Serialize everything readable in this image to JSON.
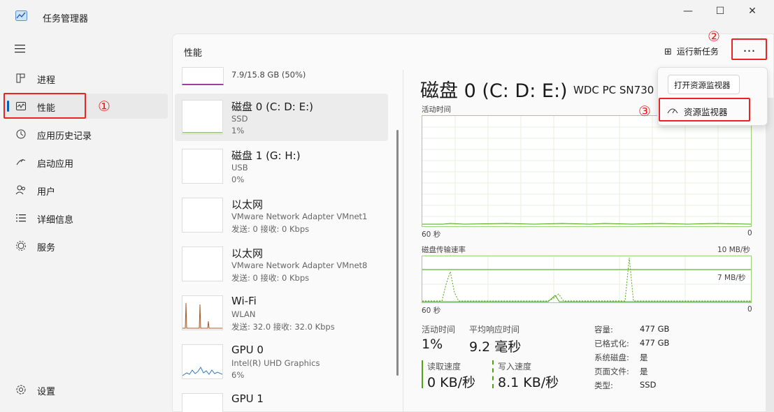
{
  "window": {
    "title": "任务管理器",
    "minimize": "—",
    "maximize": "☐",
    "close": "✕"
  },
  "sidebar": {
    "items": [
      {
        "label": "进程",
        "icon": "processes-icon"
      },
      {
        "label": "性能",
        "icon": "performance-icon"
      },
      {
        "label": "应用历史记录",
        "icon": "history-icon"
      },
      {
        "label": "启动应用",
        "icon": "startup-icon"
      },
      {
        "label": "用户",
        "icon": "users-icon"
      },
      {
        "label": "详细信息",
        "icon": "details-icon"
      },
      {
        "label": "服务",
        "icon": "services-icon"
      }
    ],
    "settings": "设置"
  },
  "annotations": {
    "n1": "①",
    "n2": "②",
    "n3": "③"
  },
  "header": {
    "title": "性能",
    "run_task": "运行新任务",
    "more": "…"
  },
  "list": {
    "partial_memory": "7.9/15.8 GB (50%)",
    "items": [
      {
        "t1": "磁盘 0 (C: D: E:)",
        "t2": "SSD",
        "t3": "1%"
      },
      {
        "t1": "磁盘 1 (G: H:)",
        "t2": "USB",
        "t3": "0%"
      },
      {
        "t1": "以太网",
        "t2": "VMware Network Adapter VMnet1",
        "t3": "发送: 0 接收: 0 Kbps"
      },
      {
        "t1": "以太网",
        "t2": "VMware Network Adapter VMnet8",
        "t3": "发送: 0 接收: 0 Kbps"
      },
      {
        "t1": "Wi-Fi",
        "t2": "WLAN",
        "t3": "发送: 32.0 接收: 32.0 Kbps"
      },
      {
        "t1": "GPU 0",
        "t2": "Intel(R) UHD Graphics",
        "t3": "6%"
      },
      {
        "t1": "GPU 1",
        "t2": "",
        "t3": ""
      }
    ]
  },
  "detail": {
    "title": "磁盘 0 (C: D: E:)",
    "model": "WDC PC SN730",
    "graph1": {
      "label": "活动时间",
      "left": "60 秒",
      "right": "0"
    },
    "graph2": {
      "label": "磁盘传输速率",
      "max": "10 MB/秒",
      "mid": "7 MB/秒",
      "left": "60 秒",
      "right": "0"
    },
    "stats": {
      "active_label": "活动时间",
      "active_value": "1%",
      "avg_label": "平均响应时间",
      "avg_value": "9.2 毫秒",
      "read_label": "读取速度",
      "read_value": "0 KB/秒",
      "write_label": "写入速度",
      "write_value": "8.1 KB/秒"
    },
    "props": [
      {
        "k": "容量:",
        "v": "477 GB"
      },
      {
        "k": "已格式化:",
        "v": "477 GB"
      },
      {
        "k": "系统磁盘:",
        "v": "是"
      },
      {
        "k": "页面文件:",
        "v": "是"
      },
      {
        "k": "类型:",
        "v": "SSD"
      }
    ]
  },
  "menu": {
    "tooltip": "打开资源监视器",
    "resmon": "资源监视器"
  },
  "colors": {
    "accent": "#005fb8",
    "annotation_red": "#e82424",
    "disk_green": "#4da60c"
  }
}
